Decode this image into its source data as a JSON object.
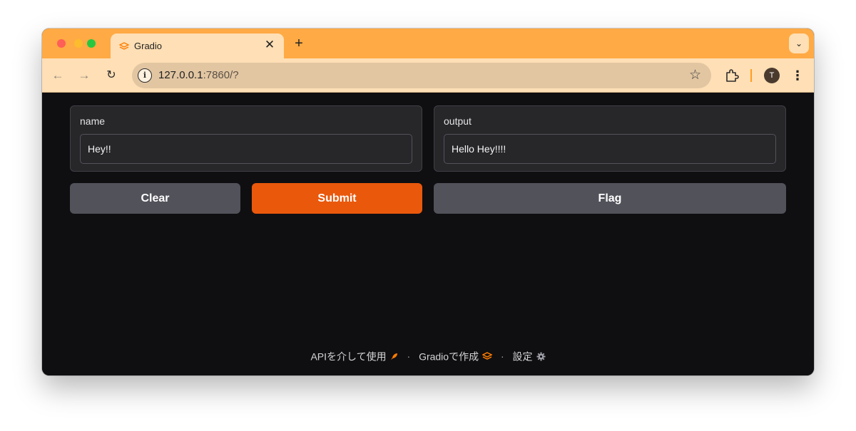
{
  "browser": {
    "tab_title": "Gradio",
    "url_host": "127.0.0.1",
    "url_rest": ":7860/?",
    "avatar_letter": "T",
    "accent_color": "#ffaa44"
  },
  "form": {
    "input_label": "name",
    "input_value": "Hey!!",
    "output_label": "output",
    "output_value": "Hello Hey!!!!"
  },
  "buttons": {
    "clear": "Clear",
    "submit": "Submit",
    "flag": "Flag",
    "submit_color": "#ea580c"
  },
  "footer": {
    "api_link": "APIを介して使用",
    "built_with": "Gradioで作成",
    "settings": "設定",
    "separator": "·"
  }
}
